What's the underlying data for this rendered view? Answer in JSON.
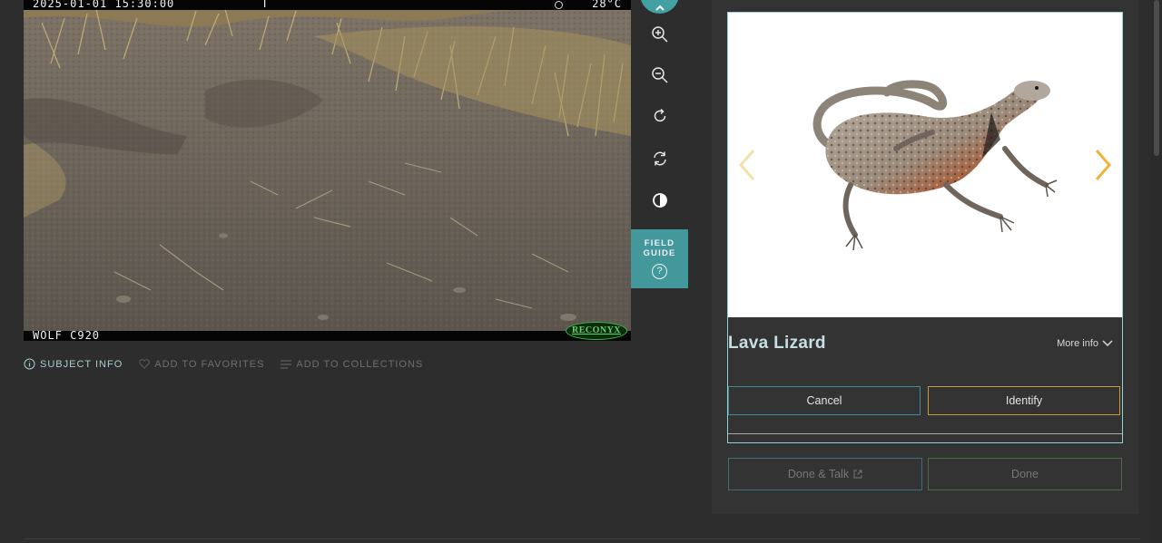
{
  "camera_image": {
    "timestamp": "2025-01-01 15:30:00",
    "flag": "T",
    "temperature": "28°C",
    "camera_model": "WOLF C920",
    "brand_logo": "RECONYX"
  },
  "tools": [
    {
      "name": "zoom-in-icon"
    },
    {
      "name": "zoom-out-icon"
    },
    {
      "name": "rotate-icon"
    },
    {
      "name": "reset-icon"
    },
    {
      "name": "invert-icon"
    }
  ],
  "field_guide": {
    "label": "FIELD\nGUIDE",
    "icon": "?"
  },
  "meta_links": {
    "subject_info": "SUBJECT INFO",
    "add_to_favorites": "ADD TO FAVORITES",
    "add_to_collections": "ADD TO COLLECTIONS"
  },
  "species_card": {
    "name": "Lava Lizard",
    "more_info": "More info",
    "cancel_label": "Cancel",
    "identify_label": "Identify"
  },
  "footer_buttons": {
    "done_talk_label": "Done & Talk",
    "done_label": "Done"
  },
  "colors": {
    "accent_teal": "#43a1a4",
    "identify_border": "#c49a3b",
    "nav_arrow": "#f0b43c"
  }
}
